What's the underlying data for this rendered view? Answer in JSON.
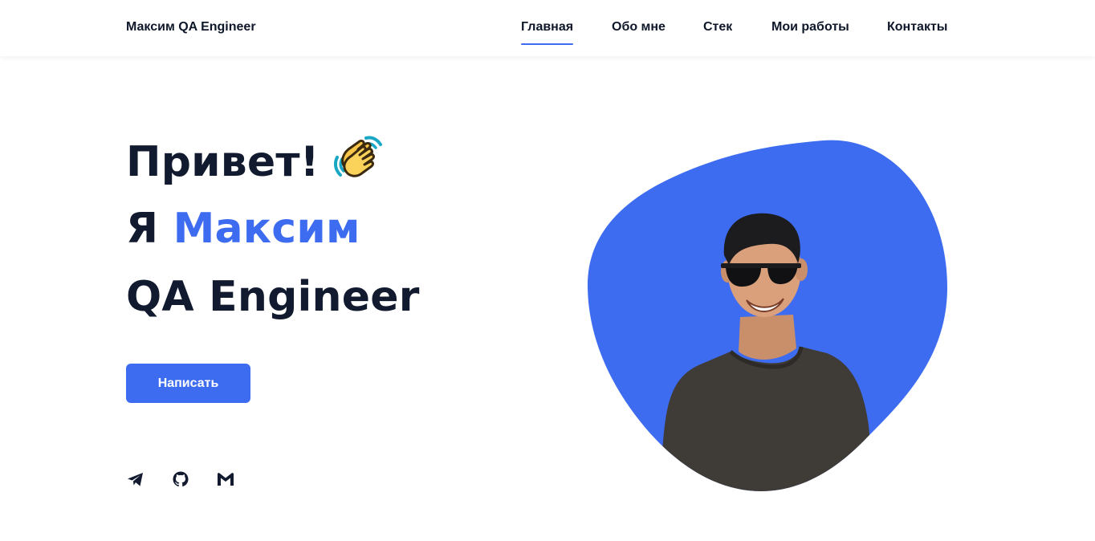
{
  "header": {
    "brand": "Максим QA Engineer",
    "nav": [
      {
        "label": "Главная",
        "active": true
      },
      {
        "label": "Обо мне",
        "active": false
      },
      {
        "label": "Стек",
        "active": false
      },
      {
        "label": "Мои работы",
        "active": false
      },
      {
        "label": "Контакты",
        "active": false
      }
    ]
  },
  "hero": {
    "greeting": "Привет!",
    "greeting_icon": "clapping-hands-emoji",
    "intro_prefix": "Я",
    "name": "Максим",
    "role": "QA Engineer",
    "cta_label": "Написать",
    "photo_icon": "portrait-photo"
  },
  "socials": [
    {
      "icon": "telegram-icon"
    },
    {
      "icon": "github-icon"
    },
    {
      "icon": "gmail-icon"
    }
  ],
  "colors": {
    "accent": "#3d6cf0",
    "text": "#111a2e",
    "background": "#ffffff"
  }
}
